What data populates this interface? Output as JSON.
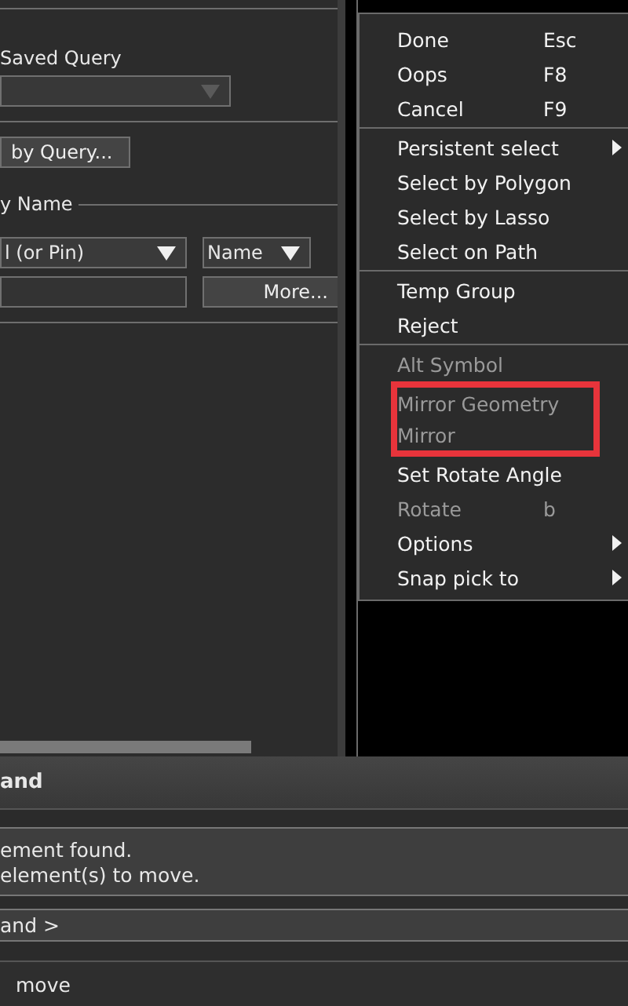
{
  "find_panel": {
    "saved_query": {
      "label": "Saved Query",
      "disabled": true
    },
    "query_button": "by Query...",
    "name_group": {
      "title": "y Name",
      "type_dropdown": "l (or Pin)",
      "field_dropdown": "Name",
      "more_button": "More..."
    }
  },
  "context_menu": {
    "sections": [
      [
        {
          "label": "Done",
          "shortcut": "Esc",
          "submenu": false,
          "disabled": false,
          "boxed": false
        },
        {
          "label": "Oops",
          "shortcut": "F8",
          "submenu": false,
          "disabled": false,
          "boxed": false
        },
        {
          "label": "Cancel",
          "shortcut": "F9",
          "submenu": false,
          "disabled": false,
          "boxed": false
        }
      ],
      [
        {
          "label": "Persistent select",
          "submenu": true,
          "disabled": false,
          "boxed": false
        },
        {
          "label": "Select by Polygon",
          "submenu": false,
          "disabled": false,
          "boxed": false
        },
        {
          "label": "Select by Lasso",
          "submenu": false,
          "disabled": false,
          "boxed": false
        },
        {
          "label": "Select on Path",
          "submenu": false,
          "disabled": false,
          "boxed": false
        }
      ],
      [
        {
          "label": "Temp Group",
          "submenu": false,
          "disabled": false,
          "boxed": false
        },
        {
          "label": "Reject",
          "submenu": false,
          "disabled": false,
          "boxed": false
        }
      ],
      [
        {
          "label": "Alt Symbol",
          "submenu": false,
          "disabled": true,
          "boxed": false
        },
        {
          "label": "Mirror Geometry",
          "submenu": false,
          "disabled": true,
          "boxed": true
        },
        {
          "label": "Mirror",
          "submenu": false,
          "disabled": true,
          "boxed": true
        },
        {
          "label": "Set Rotate Angle",
          "submenu": false,
          "disabled": false,
          "boxed": false
        },
        {
          "label": "Rotate",
          "shortcut": "b",
          "submenu": false,
          "disabled": true,
          "boxed": false
        },
        {
          "label": "Options",
          "submenu": true,
          "disabled": false,
          "boxed": false
        },
        {
          "label": "Snap pick to",
          "submenu": true,
          "disabled": false,
          "boxed": false
        }
      ]
    ]
  },
  "command_panel": {
    "title": "and",
    "messages": [
      "ement found.",
      "element(s) to move."
    ],
    "prompt": "and >",
    "status": "move"
  }
}
